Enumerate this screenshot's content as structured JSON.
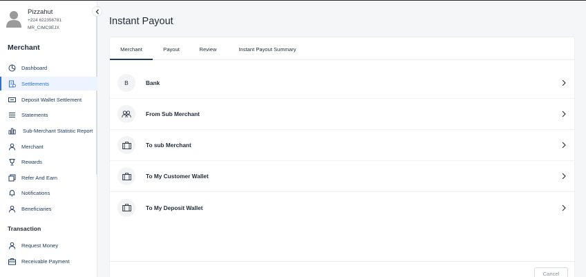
{
  "profile": {
    "name": "Pizzahut",
    "phone": "+224 622356781",
    "merchant_id": "MR_CIMC9EJX"
  },
  "sidebar": {
    "section_merchant": "Merchant",
    "items": [
      {
        "label": "Dashboard",
        "icon": "dashboard-icon"
      },
      {
        "label": "Settlements",
        "icon": "settlements-icon",
        "active": true
      },
      {
        "label": "Deposit Wallet Settlement",
        "icon": "wallet-icon"
      },
      {
        "label": "Statements",
        "icon": "list-icon"
      },
      {
        "label": "Sub-Merchant Statistic Report",
        "icon": "bar-chart-icon"
      },
      {
        "label": "Merchant",
        "icon": "user-icon"
      },
      {
        "label": "Rewards",
        "icon": "trophy-icon"
      },
      {
        "label": "Refer And Earn",
        "icon": "money-icon"
      },
      {
        "label": "Notifications",
        "icon": "bell-icon"
      },
      {
        "label": "Beneficiaries",
        "icon": "user-icon"
      }
    ],
    "section_transaction": "Transaction",
    "transaction_items": [
      {
        "label": "Request Money",
        "icon": "user-icon"
      },
      {
        "label": "Receivable Payment",
        "icon": "briefcase-icon"
      }
    ]
  },
  "main": {
    "title": "Instant Payout",
    "tabs": [
      {
        "label": "Merchant",
        "active": true
      },
      {
        "label": "Payout"
      },
      {
        "label": "Review"
      },
      {
        "label": "Instant Payout Summary"
      }
    ],
    "options": [
      {
        "badge": "B",
        "label": "Bank",
        "icon": "letter-badge"
      },
      {
        "label": "From Sub Merchant",
        "icon": "users-icon"
      },
      {
        "label": "To sub Merchant",
        "icon": "briefcase-icon"
      },
      {
        "label": "To My Customer Wallet",
        "icon": "briefcase-icon"
      },
      {
        "label": "To My Deposit Wallet",
        "icon": "briefcase-icon"
      }
    ],
    "cancel_label": "Cancel"
  },
  "colors": {
    "accent": "#2f6fdb",
    "navy": "#1f3a60",
    "background": "#f5f6f8"
  }
}
